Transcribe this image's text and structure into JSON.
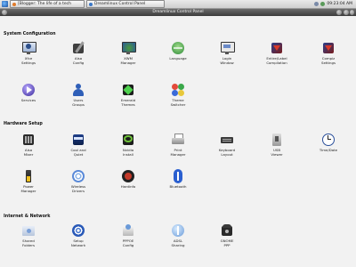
{
  "taskbar": {
    "windows": [
      {
        "label": "[Blogger: The life of a tech"
      },
      {
        "label": "Dreamlinux Control Panel"
      }
    ],
    "clock": "09:23:04 AM"
  },
  "window": {
    "title": "Dreamlinux Control Panel"
  },
  "sections": {
    "system": {
      "title": "System Configuration"
    },
    "hardware": {
      "title": "Hardware Setup"
    },
    "internet": {
      "title": "Internet & Network"
    }
  },
  "items": {
    "xfce_settings": "Xfce\nSettings",
    "alsa_config": "Alsa\nConfig",
    "xwm_manager": "XWM\nManager",
    "language": "Language",
    "login_window": "Login\nWindow",
    "entire_compilation": "Entire/Label\nCompilation",
    "compiz_settings": "Compiz\nSettings",
    "services": "Services",
    "users_groups": "Users\nGroups",
    "emerald_themes": "Emerald\nThemes",
    "theme_switcher": "Theme\nSwitcher",
    "alsa_mixer": "Alsa\nMixer",
    "cool_and_quiet": "Cool and\nQuiet",
    "nvidia_install": "Nvidia\nInstall",
    "print_manager": "Print\nManager",
    "keyboard_layout": "Keyboard\nLayout",
    "usb_viewer": "USB\nViewer",
    "time_date": "Time/Date",
    "power_manager": "Power\nManager",
    "wireless_drivers": "Wireless\nDrivers",
    "hardinfo": "Hardinfo",
    "bluetooth": "Bluetooth",
    "shared_folders": "Shared\nFolders",
    "setup_network": "Setup\nNetwork",
    "pppoe_config": "PPPOE\nConfig",
    "adsl_sharing": "ADSL\nSharing",
    "gnome_ppp": "GNOME\nPPP"
  }
}
